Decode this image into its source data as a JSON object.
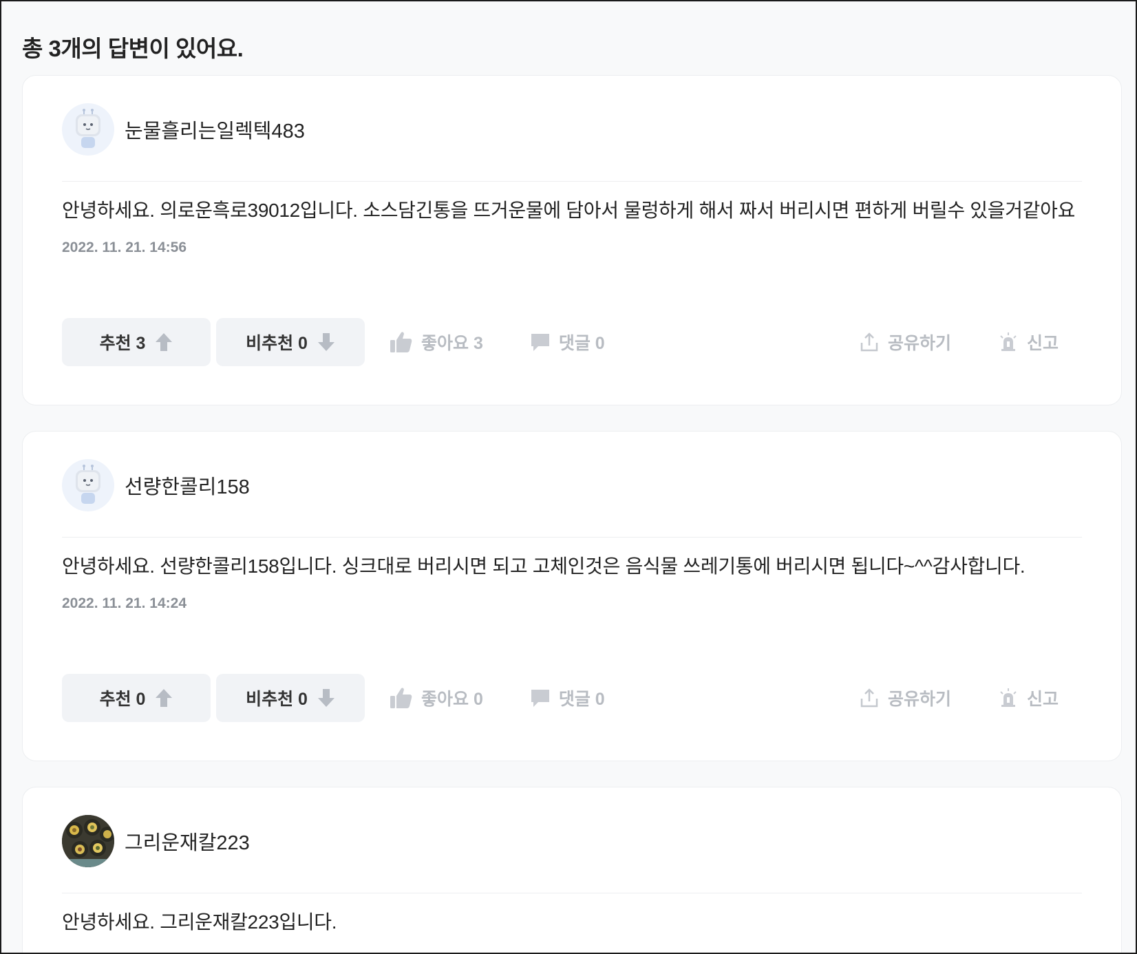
{
  "header": {
    "title": "총 3개의 답변이 있어요."
  },
  "answers": [
    {
      "author": "눈물흘리는일렉텍483",
      "content": "안녕하세요. 의로운흑로39012입니다. 소스담긴통을 뜨거운물에 담아서 물렁하게 해서 짜서 버리시면 편하게 버릴수 있을거같아요",
      "date": "2022. 11. 21. 14:56",
      "recommend_label": "추천 3",
      "unrecommend_label": "비추천 0",
      "like_label": "좋아요 3",
      "comment_label": "댓글 0",
      "share_label": "공유하기",
      "report_label": "신고"
    },
    {
      "author": "선량한콜리158",
      "content": "안녕하세요. 선량한콜리158입니다. 싱크대로 버리시면 되고 고체인것은 음식물 쓰레기통에 버리시면 됩니다~^^감사합니다.",
      "date": "2022. 11. 21. 14:24",
      "recommend_label": "추천 0",
      "unrecommend_label": "비추천 0",
      "like_label": "좋아요 0",
      "comment_label": "댓글 0",
      "share_label": "공유하기",
      "report_label": "신고"
    },
    {
      "author": "그리운재칼223",
      "content": "안녕하세요. 그리운재칼223입니다."
    }
  ],
  "colors": {
    "background": "#f8f9fa",
    "card": "#ffffff",
    "button": "#f1f3f6",
    "muted": "#b8bcc2",
    "date": "#8a8f96"
  }
}
